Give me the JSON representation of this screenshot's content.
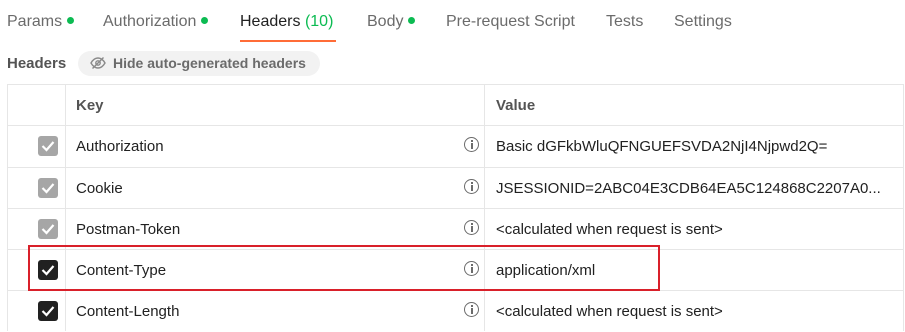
{
  "tabs": [
    {
      "label": "Params",
      "dot": true
    },
    {
      "label": "Authorization",
      "dot": true
    },
    {
      "label": "Headers",
      "count": "(10)",
      "active": true
    },
    {
      "label": "Body",
      "dot": true
    },
    {
      "label": "Pre-request Script"
    },
    {
      "label": "Tests"
    },
    {
      "label": "Settings"
    }
  ],
  "headers_section": {
    "label": "Headers",
    "hide_button": "Hide auto-generated headers"
  },
  "table": {
    "columns": {
      "key": "Key",
      "value": "Value"
    },
    "rows": [
      {
        "checked": "auto",
        "key": "Authorization",
        "value": "Basic dGFkbWluQFNGUEFSVDA2NjI4Njpwd2Q="
      },
      {
        "checked": "auto",
        "key": "Cookie",
        "value": "JSESSIONID=2ABC04E3CDB64EA5C124868C2207A0..."
      },
      {
        "checked": "auto",
        "key": "Postman-Token",
        "value": "<calculated when request is sent>"
      },
      {
        "checked": "true",
        "key": "Content-Type",
        "value": "application/xml"
      },
      {
        "checked": "true",
        "key": "Content-Length",
        "value": "<calculated when request is sent>"
      }
    ]
  },
  "colors": {
    "accent": "#ff6c37",
    "dot": "#0cbb52",
    "highlight": "#d9202a"
  }
}
